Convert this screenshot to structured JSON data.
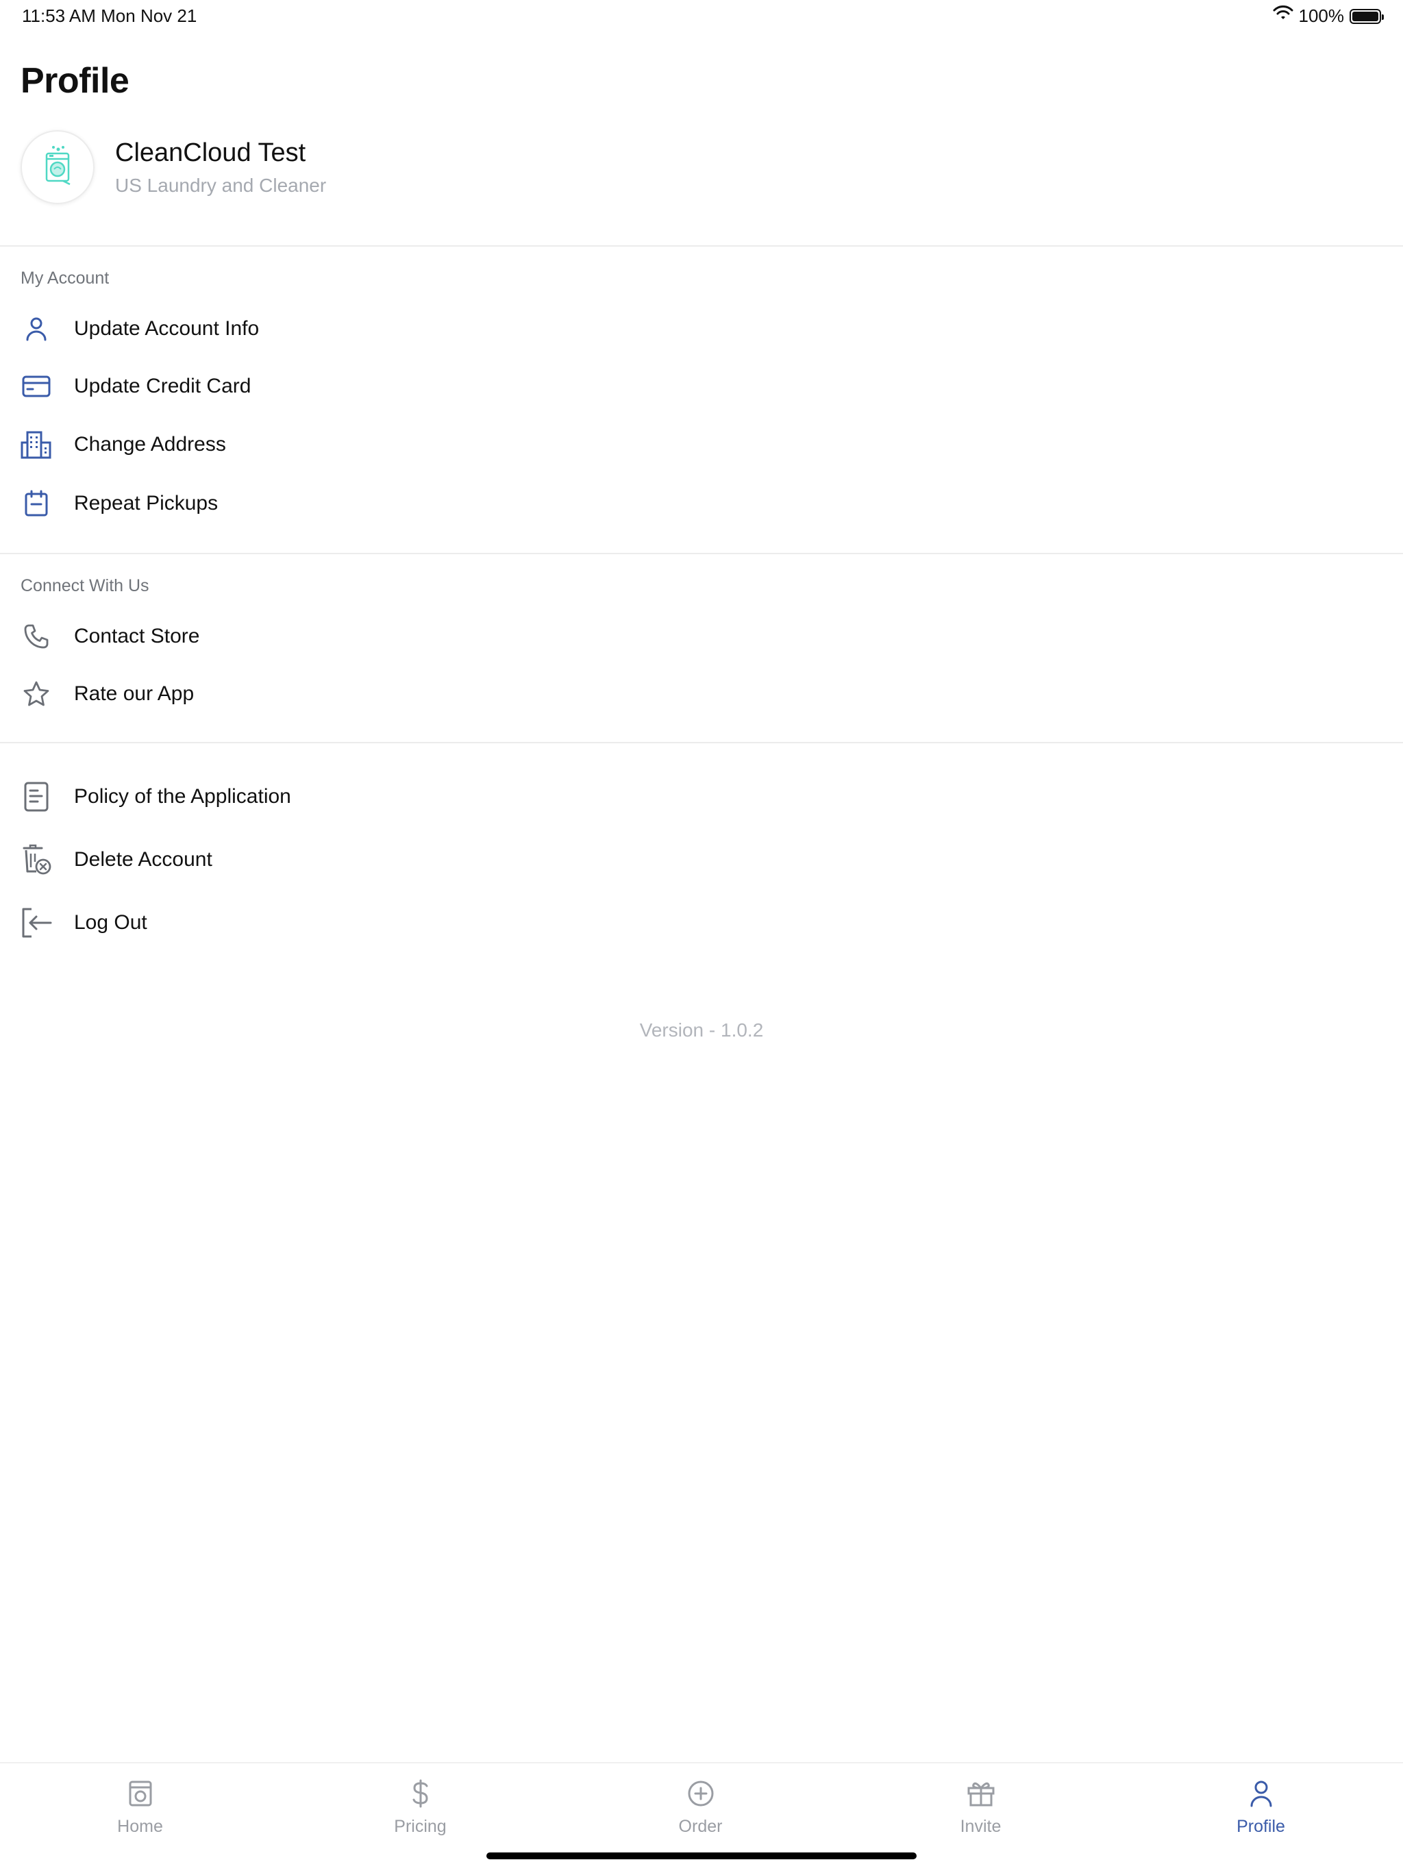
{
  "status": {
    "time": "11:53 AM   Mon Nov 21",
    "battery": "100%",
    "battery_level": 1.0,
    "icons": [
      "wifi-icon",
      "battery-icon"
    ]
  },
  "page": {
    "title": "Profile"
  },
  "profile": {
    "name": "CleanCloud Test",
    "subtitle": "US Laundry and Cleaner",
    "avatar_icon": "washing-machine-icon",
    "avatar_color": "#4fd8c4"
  },
  "sections": {
    "my_account": {
      "label": "My Account",
      "items": [
        {
          "label": "Update Account Info",
          "icon": "user-icon"
        },
        {
          "label": "Update Credit Card",
          "icon": "credit-card-icon"
        },
        {
          "label": "Change Address",
          "icon": "building-icon"
        },
        {
          "label": "Repeat Pickups",
          "icon": "calendar-icon"
        }
      ]
    },
    "connect": {
      "label": "Connect With Us",
      "items": [
        {
          "label": "Contact Store",
          "icon": "phone-icon"
        },
        {
          "label": "Rate our App",
          "icon": "star-icon"
        }
      ]
    },
    "other": {
      "items": [
        {
          "label": "Policy of the Application",
          "icon": "document-icon"
        },
        {
          "label": "Delete Account",
          "icon": "delete-icon"
        },
        {
          "label": "Log Out",
          "icon": "logout-icon"
        }
      ]
    }
  },
  "version": "Version - 1.0.2",
  "tabs": [
    {
      "label": "Home",
      "icon": "home-icon",
      "active": false
    },
    {
      "label": "Pricing",
      "icon": "dollar-icon",
      "active": false
    },
    {
      "label": "Order",
      "icon": "plus-circle-icon",
      "active": false
    },
    {
      "label": "Invite",
      "icon": "gift-icon",
      "active": false
    },
    {
      "label": "Profile",
      "icon": "user-icon",
      "active": true
    }
  ],
  "colors": {
    "accent_blue": "#3a5ba9",
    "icon_gray": "#6b6f76",
    "tab_inactive": "#9a9da3",
    "divider": "#ececec"
  }
}
